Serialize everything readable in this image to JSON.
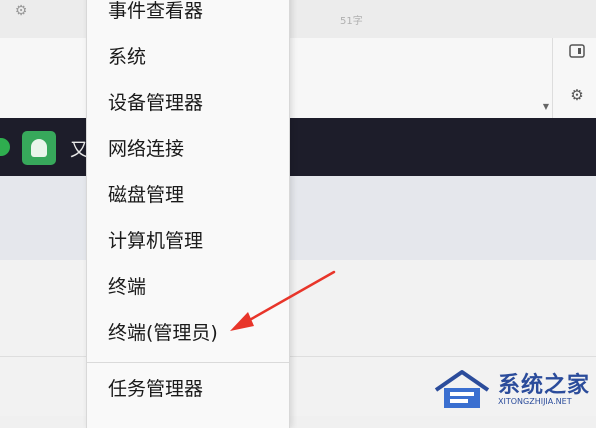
{
  "background": {
    "top_bar_icon": "gear-icon",
    "top_bar_text": "51字",
    "right_icons": [
      "panel-icon",
      "gear-icon"
    ],
    "taskbar_glyph": "又"
  },
  "context_menu": {
    "items": [
      {
        "label": "事件查看器"
      },
      {
        "label": "系统"
      },
      {
        "label": "设备管理器"
      },
      {
        "label": "网络连接"
      },
      {
        "label": "磁盘管理"
      },
      {
        "label": "计算机管理"
      },
      {
        "label": "终端"
      },
      {
        "label": "终端(管理员)"
      },
      {
        "label": "任务管理器"
      }
    ]
  },
  "annotation": {
    "arrow_color": "#e8352a"
  },
  "watermark": {
    "name": "系统之家",
    "url": "XITONGZHIJIA.NET",
    "color": "#2b4c9b"
  }
}
